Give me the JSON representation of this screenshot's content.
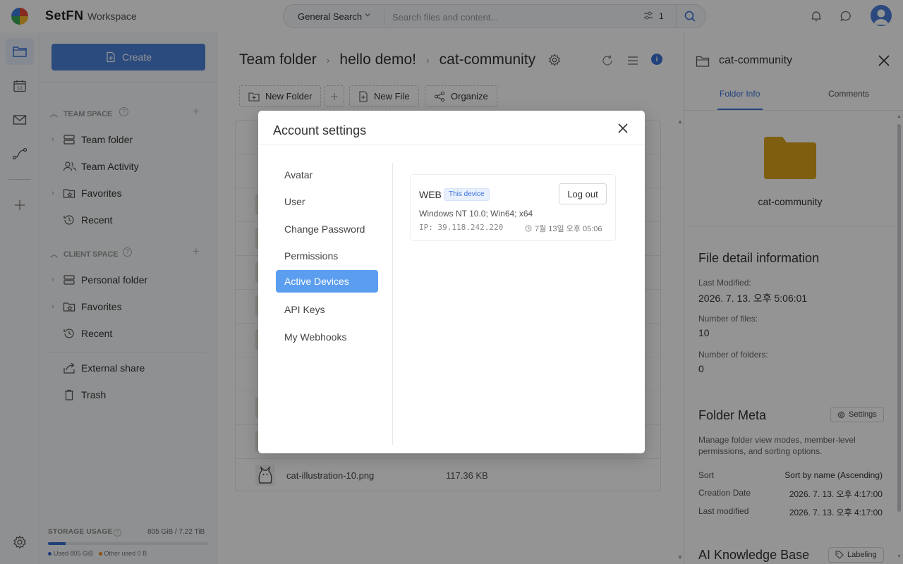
{
  "app": {
    "brand": "SetFN",
    "workspace": "Workspace"
  },
  "search": {
    "mode": "General Search",
    "placeholder": "Search files and content...",
    "filter_count": "1"
  },
  "sidebar": {
    "create_label": "Create",
    "team_space": {
      "heading": "TEAM SPACE",
      "items": [
        {
          "label": "Team folder"
        },
        {
          "label": "Team Activity"
        },
        {
          "label": "Favorites"
        },
        {
          "label": "Recent"
        }
      ]
    },
    "client_space": {
      "heading": "CLIENT SPACE",
      "items": [
        {
          "label": "Personal folder"
        },
        {
          "label": "Favorites"
        },
        {
          "label": "Recent"
        }
      ]
    },
    "extra_items": [
      {
        "label": "External share"
      },
      {
        "label": "Trash"
      }
    ],
    "storage": {
      "label": "STORAGE USAGE",
      "value": "805 GiB / 7.22 TiB",
      "used_fraction": 0.11,
      "used_legend": "Used 805 GiB",
      "other_legend": "Other used 0 B",
      "used_color": "#3a6fd0",
      "other_color": "#f08a24"
    }
  },
  "main": {
    "breadcrumb": [
      "Team folder",
      "hello demo!",
      "cat-community"
    ],
    "toolbar": {
      "new_folder": "New Folder",
      "new_file": "New File",
      "organize": "Organize"
    },
    "last_file": {
      "name": "cat-illustration-10.png",
      "size": "117.36 KB"
    }
  },
  "right_panel": {
    "title": "cat-community",
    "tabs": [
      "Folder Info",
      "Comments"
    ],
    "active_tab": "Folder Info",
    "folder_name": "cat-community",
    "folder_color": "#d9a21a",
    "file_detail": {
      "heading": "File detail information",
      "last_modified_label": "Last Modified:",
      "last_modified_value": "2026. 7. 13. 오후 5:06:01",
      "num_files_label": "Number of files:",
      "num_files_value": "10",
      "num_folders_label": "Number of folders:",
      "num_folders_value": "0"
    },
    "folder_meta": {
      "heading": "Folder Meta",
      "settings_label": "Settings",
      "description": "Manage folder view modes, member-level permissions, and sorting options.",
      "rows": [
        {
          "key": "Sort",
          "value": "Sort by name (Ascending)"
        },
        {
          "key": "Creation Date",
          "value": "2026. 7. 13. 오후 4:17:00"
        },
        {
          "key": "Last modified",
          "value": "2026. 7. 13. 오후 4:17:00"
        }
      ]
    },
    "ai_kb": {
      "heading": "AI Knowledge Base",
      "labeling_label": "Labeling"
    }
  },
  "dialog": {
    "title": "Account settings",
    "menu": [
      "Avatar",
      "User",
      "Change Password",
      "Permissions",
      "Active Devices",
      "API Keys",
      "My Webhooks"
    ],
    "active_menu": "Active Devices",
    "device": {
      "name": "WEB",
      "badge": "This device",
      "logout_label": "Log out",
      "os": "Windows NT 10.0; Win64; x64",
      "ip": "IP: 39.118.242.220",
      "time": "7월 13일 오후 05:06"
    }
  },
  "colors": {
    "accent": "#4a82d9",
    "active_menu": "#5b9ef0"
  }
}
